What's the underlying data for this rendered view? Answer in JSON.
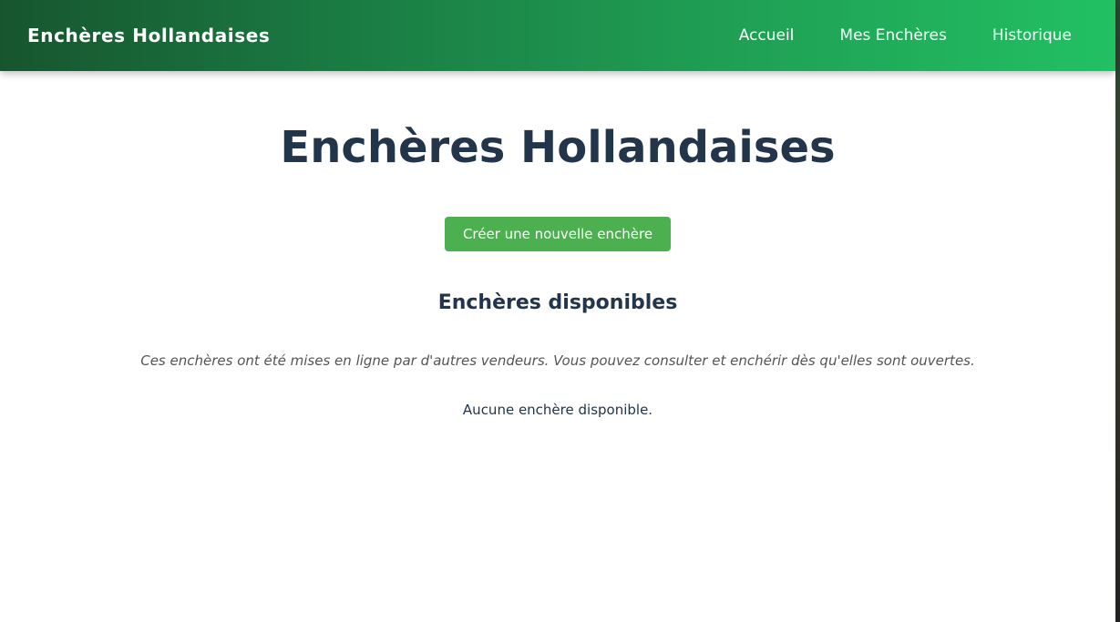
{
  "navbar": {
    "brand": "Enchères Hollandaises",
    "links": [
      "Accueil",
      "Mes Enchères",
      "Historique"
    ]
  },
  "main": {
    "title": "Enchères Hollandaises",
    "create_button_label": "Créer une nouvelle enchère",
    "section_title": "Enchères disponibles",
    "info_text": "Ces enchères ont été mises en ligne par d'autres vendeurs. Vous pouvez consulter et enchérir dès qu'elles sont ouvertes.",
    "empty_text": "Aucune enchère disponible."
  },
  "colors": {
    "navbar_gradient_start": "#17552f",
    "navbar_gradient_end": "#22c063",
    "button_green": "#4caf50",
    "heading_color": "#22354b"
  }
}
